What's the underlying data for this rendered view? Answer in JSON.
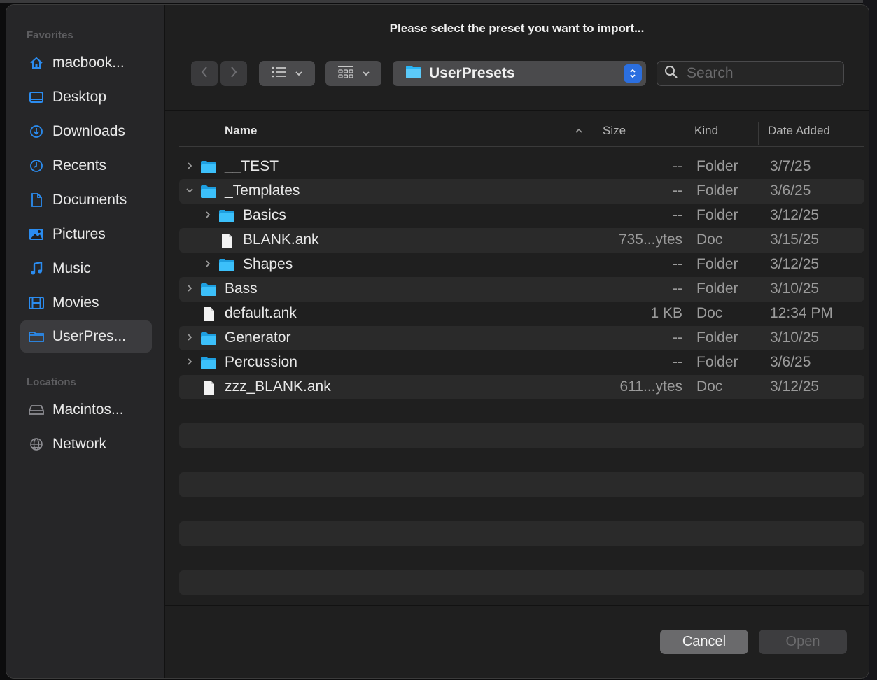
{
  "dialog": {
    "title": "Please select the preset you want to import...",
    "current_folder": "UserPresets",
    "search_placeholder": "Search",
    "cancel_label": "Cancel",
    "open_label": "Open"
  },
  "sidebar": {
    "favorites_title": "Favorites",
    "favorites": [
      {
        "label": "macbook...",
        "icon": "home-icon"
      },
      {
        "label": "Desktop",
        "icon": "desktop-icon"
      },
      {
        "label": "Downloads",
        "icon": "downloads-icon"
      },
      {
        "label": "Recents",
        "icon": "recents-icon"
      },
      {
        "label": "Documents",
        "icon": "document-icon"
      },
      {
        "label": "Pictures",
        "icon": "pictures-icon"
      },
      {
        "label": "Music",
        "icon": "music-icon"
      },
      {
        "label": "Movies",
        "icon": "movies-icon"
      },
      {
        "label": "UserPres...",
        "icon": "folder-icon",
        "selected": true
      }
    ],
    "locations_title": "Locations",
    "locations": [
      {
        "label": "Macintos...",
        "icon": "hard-drive-icon"
      },
      {
        "label": "Network",
        "icon": "network-icon"
      }
    ]
  },
  "columns": {
    "name": "Name",
    "size": "Size",
    "kind": "Kind",
    "date_added": "Date Added"
  },
  "files": [
    {
      "name": "__TEST",
      "type": "folder",
      "disclosure": "collapsed",
      "depth": 0,
      "size": "--",
      "kind": "Folder",
      "date": "3/7/25"
    },
    {
      "name": "_Templates",
      "type": "folder",
      "disclosure": "expanded",
      "depth": 0,
      "size": "--",
      "kind": "Folder",
      "date": "3/6/25"
    },
    {
      "name": "Basics",
      "type": "folder",
      "disclosure": "collapsed",
      "depth": 1,
      "size": "--",
      "kind": "Folder",
      "date": "3/12/25"
    },
    {
      "name": "BLANK.ank",
      "type": "doc",
      "disclosure": "none",
      "depth": 1,
      "size": "735...ytes",
      "kind": "Doc",
      "date": "3/15/25"
    },
    {
      "name": "Shapes",
      "type": "folder",
      "disclosure": "collapsed",
      "depth": 1,
      "size": "--",
      "kind": "Folder",
      "date": "3/12/25"
    },
    {
      "name": "Bass",
      "type": "folder",
      "disclosure": "collapsed",
      "depth": 0,
      "size": "--",
      "kind": "Folder",
      "date": "3/10/25"
    },
    {
      "name": "default.ank",
      "type": "doc",
      "disclosure": "none",
      "depth": 0,
      "size": "1 KB",
      "kind": "Doc",
      "date": "12:34 PM"
    },
    {
      "name": "Generator",
      "type": "folder",
      "disclosure": "collapsed",
      "depth": 0,
      "size": "--",
      "kind": "Folder",
      "date": "3/10/25"
    },
    {
      "name": "Percussion",
      "type": "folder",
      "disclosure": "collapsed",
      "depth": 0,
      "size": "--",
      "kind": "Folder",
      "date": "3/6/25"
    },
    {
      "name": "zzz_BLANK.ank",
      "type": "doc",
      "disclosure": "none",
      "depth": 0,
      "size": "611...ytes",
      "kind": "Doc",
      "date": "3/12/25"
    }
  ],
  "colors": {
    "accent": "#2b6fe0",
    "folder": "#29b5f6",
    "background": "#1f1f1f",
    "sidebar": "#262628"
  }
}
